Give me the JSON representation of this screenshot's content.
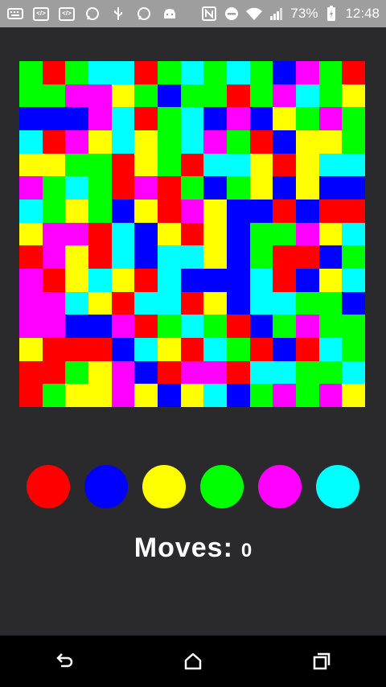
{
  "status_bar": {
    "battery_percent": "73%",
    "time": "12:48",
    "left_icons": [
      "keyboard-icon",
      "code-icon",
      "code-icon",
      "whatsapp-icon",
      "usb-icon",
      "whatsapp-icon",
      "android-icon"
    ],
    "right_icons": [
      "nfc-icon",
      "do-not-disturb-icon",
      "wifi-icon",
      "signal-icon"
    ]
  },
  "colors": {
    "R": "#ff0000",
    "B": "#0000ff",
    "Y": "#ffff00",
    "G": "#00ff00",
    "M": "#ff00ff",
    "C": "#00ffff"
  },
  "board": {
    "rows": [
      "GRGCCRGCGCGBMGR",
      "GGMMYGBGGRGMCGY",
      "BBBMCRGCBMBYGMG",
      "CRMYCYGCMGRBYYG",
      "YYGGRYGRCCYRYCC",
      "MGCGRMRGBGYBYBB",
      "CGYGBYRMYBBRBRR",
      "YMMRCBYRYBGGMYC",
      "RMYRCBCCYBGRRBG",
      "MRYCYRCBBBCRBYC",
      "MMCYRCCRYBCCGGB",
      "MMBBMRGCGRBGMGG",
      "YRRRBCYRCGRBRCG",
      "RRGYMBRMMRCCGGC",
      "RGYYMYBYCBGMGMY"
    ]
  },
  "palette": [
    "R",
    "B",
    "Y",
    "G",
    "M",
    "C"
  ],
  "moves": {
    "label": "Moves:",
    "value": "0"
  },
  "nav": [
    "back-icon",
    "home-icon",
    "recents-icon"
  ]
}
